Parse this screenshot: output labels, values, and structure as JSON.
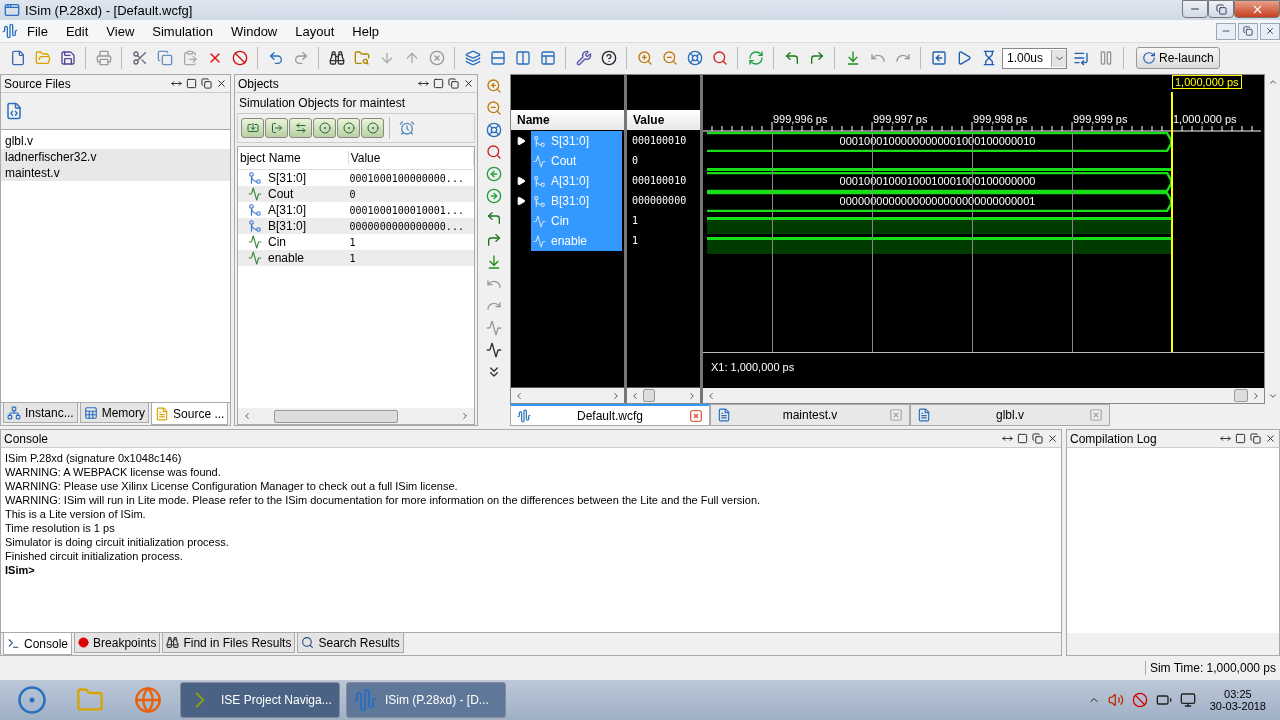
{
  "window": {
    "title": "ISim (P.28xd) - [Default.wcfg]"
  },
  "menu": [
    "File",
    "Edit",
    "View",
    "Simulation",
    "Window",
    "Layout",
    "Help"
  ],
  "toolbar": {
    "run_time": "1.00us",
    "relaunch": "Re-launch"
  },
  "source_files": {
    "title": "Source Files",
    "items": [
      {
        "label": "glbl.v",
        "selected": false
      },
      {
        "label": "ladnerfischer32.v",
        "selected": true
      },
      {
        "label": "maintest.v",
        "selected": true
      }
    ],
    "tabs": [
      {
        "label": "Instanc...",
        "selected": false
      },
      {
        "label": "Memory",
        "selected": false
      },
      {
        "label": "Source ...",
        "selected": true
      }
    ]
  },
  "objects": {
    "title": "Objects",
    "subtitle": "Simulation Objects for maintest",
    "columns": [
      "bject Name",
      "Value"
    ],
    "rows": [
      {
        "kind": "bus",
        "name": "S[31:0]",
        "value": "0001000100000000..."
      },
      {
        "kind": "bit",
        "name": "Cout",
        "value": "0"
      },
      {
        "kind": "bus",
        "name": "A[31:0]",
        "value": "0001000100010001..."
      },
      {
        "kind": "bus",
        "name": "B[31:0]",
        "value": "0000000000000000..."
      },
      {
        "kind": "bit",
        "name": "Cin",
        "value": "1"
      },
      {
        "kind": "bit",
        "name": "enable",
        "value": "1"
      }
    ]
  },
  "wave": {
    "columns": [
      "Name",
      "Value"
    ],
    "cursor_label": "1,000,000 ps",
    "ruler": [
      "999,996 ps",
      "999,997 ps",
      "999,998 ps",
      "999,999 ps",
      "1,000,000 ps"
    ],
    "signals": [
      {
        "kind": "bus",
        "name": "S[31:0]",
        "value": "000100010",
        "wave_text": "00010001000000000001000100000010",
        "selected": true
      },
      {
        "kind": "bit",
        "name": "Cout",
        "value": "0",
        "high": false,
        "selected": true
      },
      {
        "kind": "bus",
        "name": "A[31:0]",
        "value": "000100010",
        "wave_text": "00010001000100010001000100000000",
        "selected": true
      },
      {
        "kind": "bus",
        "name": "B[31:0]",
        "value": "000000000",
        "wave_text": "00000000000000000000000000000001",
        "selected": true
      },
      {
        "kind": "bit",
        "name": "Cin",
        "value": "1",
        "high": true,
        "selected": true
      },
      {
        "kind": "bit",
        "name": "enable",
        "value": "1",
        "high": true,
        "selected": true
      }
    ],
    "x1": "X1: 1,000,000 ps"
  },
  "editor_tabs": [
    {
      "label": "Default.wcfg",
      "selected": true
    },
    {
      "label": "maintest.v",
      "selected": false
    },
    {
      "label": "glbl.v",
      "selected": false
    }
  ],
  "console": {
    "title": "Console",
    "lines": [
      {
        "kind": "output",
        "text": "ISim P.28xd (signature 0x1048c146)"
      },
      {
        "kind": "output",
        "text": "WARNING: A WEBPACK license was found."
      },
      {
        "kind": "output",
        "text": "WARNING: Please use Xilinx License Configuration Manager to check out a full ISim license."
      },
      {
        "kind": "output",
        "text": "WARNING: ISim will run in Lite mode. Please refer to the ISim documentation for more information on the differences between the Lite and the Full version."
      },
      {
        "kind": "output",
        "text": "This is a Lite version of ISim."
      },
      {
        "kind": "output",
        "text": "Time resolution is 1 ps"
      },
      {
        "kind": "output",
        "text": "Simulator is doing circuit initialization process."
      },
      {
        "kind": "output",
        "text": "Finished circuit initialization process."
      },
      {
        "kind": "prompt",
        "text": "ISim>"
      }
    ],
    "tabs": [
      {
        "label": "Console",
        "selected": true
      },
      {
        "label": "Breakpoints",
        "selected": false
      },
      {
        "label": "Find in Files Results",
        "selected": false
      },
      {
        "label": "Search Results",
        "selected": false
      }
    ]
  },
  "compilation_log": {
    "title": "Compilation Log"
  },
  "status_bar": {
    "sim_time": "Sim Time: 1,000,000 ps"
  },
  "taskbar": {
    "apps": [
      {
        "label": "ISE Project Naviga...",
        "selected": false
      },
      {
        "label": "ISim (P.28xd) - [D...",
        "selected": true
      }
    ],
    "time": "03:25",
    "date": "30-03-2018"
  }
}
